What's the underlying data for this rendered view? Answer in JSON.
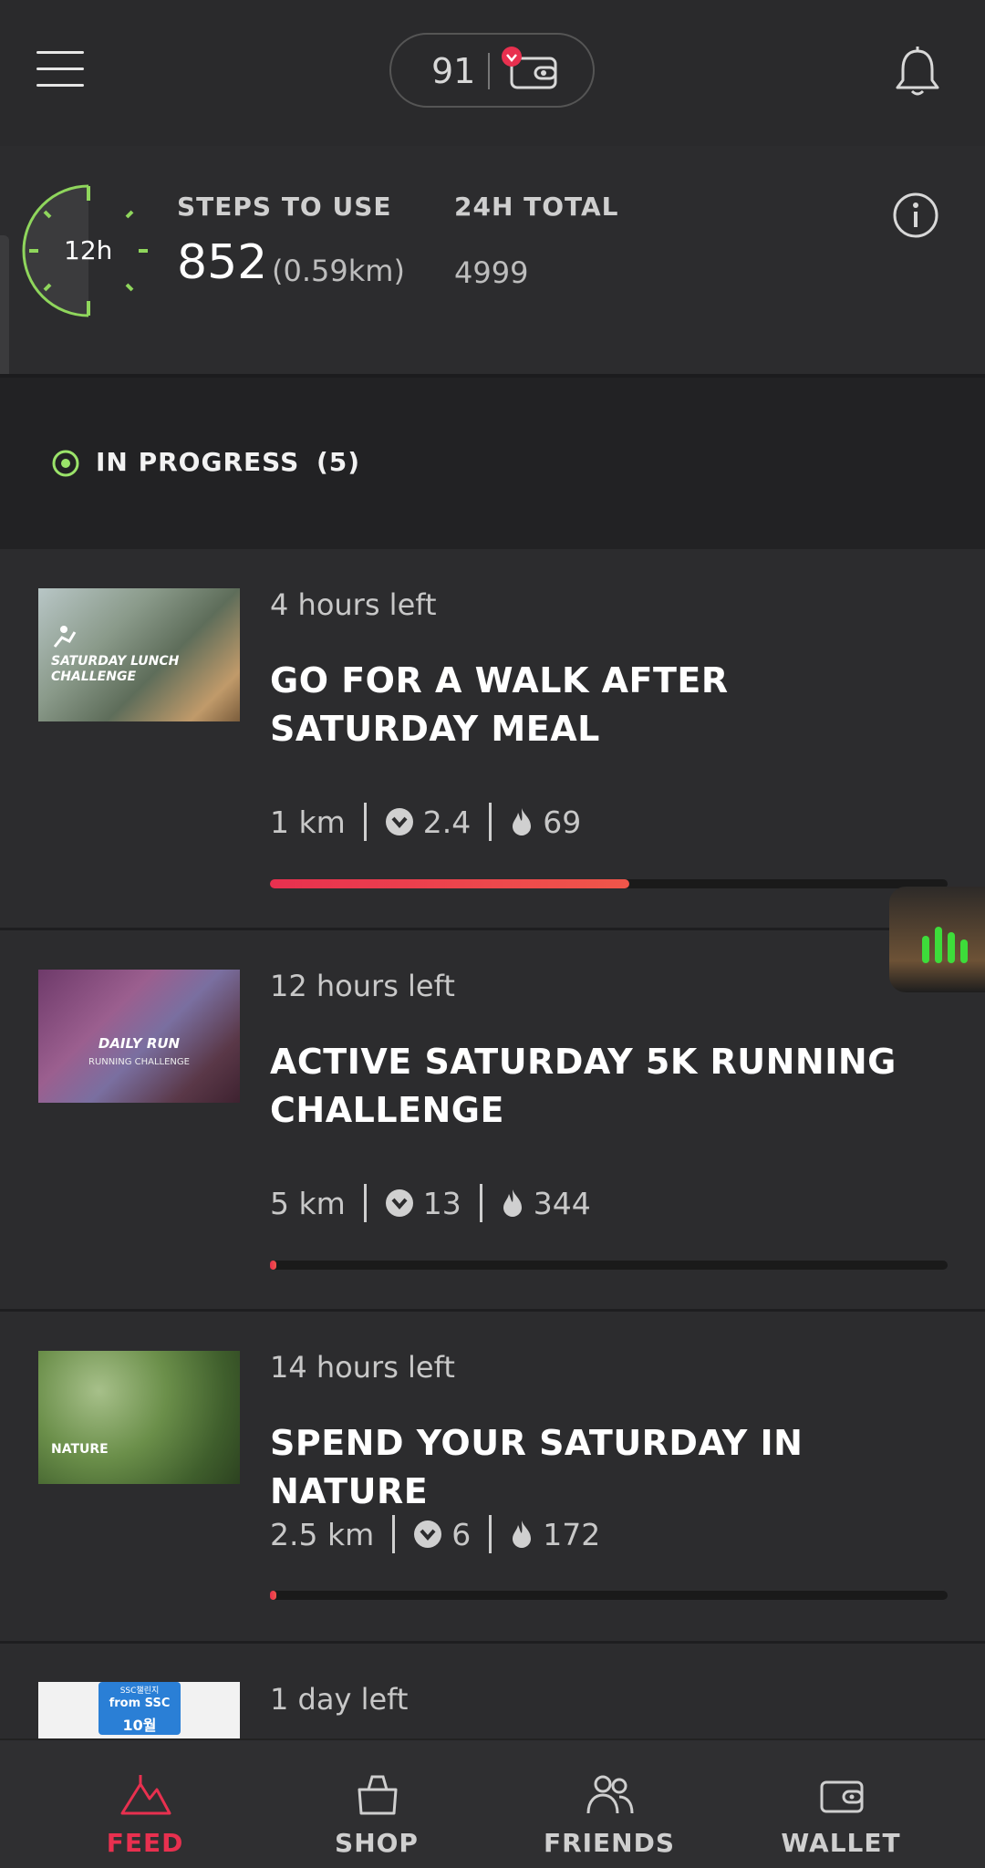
{
  "header": {
    "wallet_count": "91"
  },
  "steps": {
    "dial_label": "12h",
    "steps_label": "STEPS TO USE",
    "steps_value": "852",
    "steps_km": "(0.59km)",
    "total_label": "24H TOTAL",
    "total_value": "4999"
  },
  "section": {
    "label": "IN PROGRESS",
    "count": "(5)",
    "accent": "#9be36a"
  },
  "cards": [
    {
      "time_left": "4 hours left",
      "title": "GO FOR A WALK AFTER SATURDAY MEAL",
      "distance": "1 km",
      "coins": "2.4",
      "calories": "69",
      "progress": 0.53,
      "thumb_text": "SATURDAY LUNCH CHALLENGE"
    },
    {
      "time_left": "12 hours left",
      "title": "ACTIVE SATURDAY 5K RUNNING CHALLENGE",
      "distance": "5 km",
      "coins": "13",
      "calories": "344",
      "progress": 0.01,
      "thumb_text": "DAILY RUN",
      "thumb_subtext": "RUNNING CHALLENGE"
    },
    {
      "time_left": "14 hours left",
      "title": "SPEND YOUR SATURDAY IN NATURE",
      "distance": "2.5 km",
      "coins": "6",
      "calories": "172",
      "progress": 0.01,
      "thumb_text": "NATURE"
    },
    {
      "time_left": "1 day left",
      "thumb_text": "from SSC",
      "thumb_subtext": "10월",
      "thumb_top": "SSC챌린지"
    }
  ],
  "nav": [
    {
      "label": "FEED",
      "icon": "mountain-icon",
      "active": true
    },
    {
      "label": "SHOP",
      "icon": "bag-icon"
    },
    {
      "label": "FRIENDS",
      "icon": "friends-icon"
    },
    {
      "label": "WALLET",
      "icon": "wallet-icon"
    }
  ],
  "colors": {
    "accent": "#e8304f",
    "background": "#2a2a2c",
    "green": "#9be36a"
  }
}
